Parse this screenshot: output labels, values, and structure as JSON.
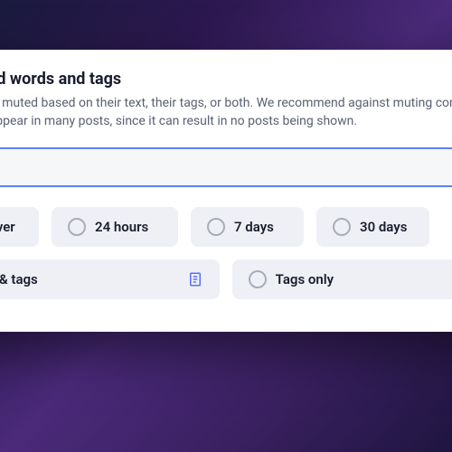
{
  "modal": {
    "title": "Add muted words and tags",
    "description": "Posts can be muted based on their text, their tags, or both. We recommend against muting common words that appear in many posts, since it can result in no posts being shown.",
    "input": {
      "value": "",
      "placeholder": ""
    },
    "duration": {
      "options": [
        {
          "label": "Forever"
        },
        {
          "label": "24 hours"
        },
        {
          "label": "7 days"
        },
        {
          "label": "30 days"
        }
      ]
    },
    "scope": {
      "options": [
        {
          "label": "Text & tags"
        },
        {
          "label": "Tags only"
        }
      ]
    }
  }
}
